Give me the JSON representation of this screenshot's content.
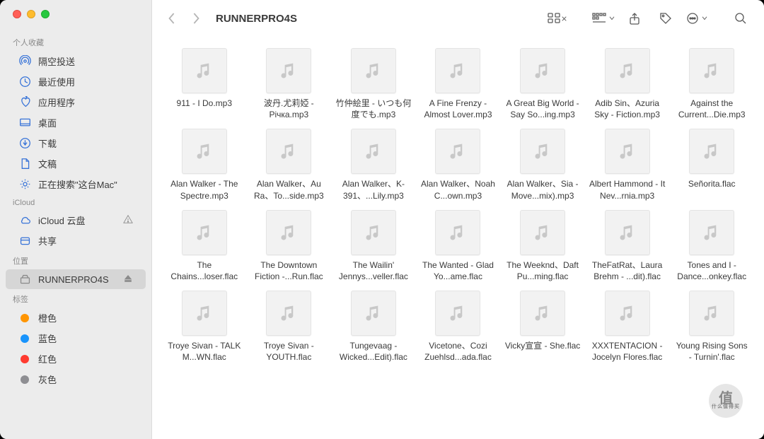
{
  "window_title": "RUNNERPRO4S",
  "sidebar": {
    "sections": [
      {
        "label": "个人收藏",
        "items": [
          {
            "icon": "airdrop",
            "label": "隔空投送"
          },
          {
            "icon": "clock",
            "label": "最近使用"
          },
          {
            "icon": "apps",
            "label": "应用程序"
          },
          {
            "icon": "desktop",
            "label": "桌面"
          },
          {
            "icon": "download",
            "label": "下载"
          },
          {
            "icon": "doc",
            "label": "文稿"
          },
          {
            "icon": "gear",
            "label": "正在搜索\"这台Mac\""
          }
        ]
      },
      {
        "label": "iCloud",
        "items": [
          {
            "icon": "cloud",
            "label": "iCloud 云盘",
            "trail": "warn"
          },
          {
            "icon": "share",
            "label": "共享"
          }
        ]
      },
      {
        "label": "位置",
        "items": [
          {
            "icon": "disk",
            "label": "RUNNERPRO4S",
            "active": true,
            "trail": "eject"
          }
        ]
      },
      {
        "label": "标签",
        "tags": [
          {
            "color": "#ff9500",
            "label": "橙色"
          },
          {
            "color": "#1994fc",
            "label": "蓝色"
          },
          {
            "color": "#ff3b30",
            "label": "红色"
          },
          {
            "color": "#8e8e92",
            "label": "灰色"
          }
        ]
      }
    ]
  },
  "files": [
    "911 - I Do.mp3",
    "波丹.尤莉婭 - Річка.mp3",
    "竹仲絵里 - いつも何度でも.mp3",
    "A Fine Frenzy - Almost Lover.mp3",
    "A Great Big World - Say So...ing.mp3",
    "Adib Sin、Azuria Sky - Fiction.mp3",
    "Against the Current...Die.mp3",
    "Alan Walker - The Spectre.mp3",
    "Alan Walker、Au Ra、To...side.mp3",
    "Alan Walker、K-391、...Lily.mp3",
    "Alan Walker、Noah C...own.mp3",
    "Alan Walker、Sia - Move...mix).mp3",
    "Albert Hammond - It Nev...rnia.mp3",
    "Señorita.flac",
    "The Chains...loser.flac",
    "The Downtown Fiction -...Run.flac",
    "The Wailin' Jennys...veller.flac",
    "The Wanted - Glad Yo...ame.flac",
    "The Weeknd、Daft Pu...ming.flac",
    "TheFatRat、Laura Brehm - ...dit).flac",
    "Tones and I - Dance...onkey.flac",
    "Troye Sivan - TALK M...WN.flac",
    "Troye Sivan - YOUTH.flac",
    "Tungevaag - Wicked...Edit).flac",
    "Vicetone、Cozi Zuehlsd...ada.flac",
    "Vicky宣宣 - She.flac",
    "XXXTENTACION - Jocelyn Flores.flac",
    "Young Rising Sons - Turnin'.flac"
  ]
}
